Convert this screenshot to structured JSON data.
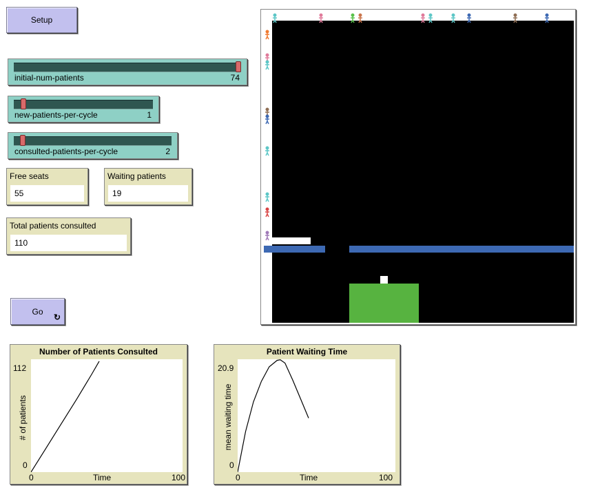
{
  "buttons": {
    "setup": {
      "label": "Setup"
    },
    "go": {
      "label": "Go",
      "forever_icon": "forever-arrows-icon",
      "forever_glyph": "↻"
    }
  },
  "sliders": [
    {
      "name": "initial-num-patients",
      "value": "74",
      "level": 1.0
    },
    {
      "name": "new-patients-per-cycle",
      "value": "1",
      "level": 0.05
    },
    {
      "name": "consulted-patients-per-cycle",
      "value": "2",
      "level": 0.04
    }
  ],
  "monitors": {
    "free_seats": {
      "label": "Free seats",
      "value": "55"
    },
    "waiting_patients": {
      "label": "Waiting patients",
      "value": "19"
    },
    "total_consulted": {
      "label": "Total patients consulted",
      "value": "110"
    }
  },
  "world": {
    "background": "#000000",
    "wall_color": "#3d69b3",
    "doctor_room_color": "#57b340",
    "patient_colors": [
      "#5cc7c7",
      "#e07a9a",
      "#58c24a",
      "#c9744a",
      "#3d69b3",
      "#8f6e54",
      "#f07a30",
      "#a07ab8",
      "#d94444"
    ]
  },
  "plots": [
    {
      "title": "Number of Patients Consulted",
      "ylabel": "# of patients",
      "xlabel": "Time",
      "xmin": "0",
      "xmax": "100",
      "ymin": "0",
      "ymax": "112"
    },
    {
      "title": "Patient Waiting Time",
      "ylabel": "mean waiting time",
      "xlabel": "Time",
      "xmin": "0",
      "xmax": "100",
      "ymin": "0",
      "ymax": "20.9"
    }
  ],
  "chart_data": [
    {
      "type": "line",
      "title": "Number of Patients Consulted",
      "xlabel": "Time",
      "ylabel": "# of patients",
      "xlim": [
        0,
        100
      ],
      "ylim": [
        0,
        112
      ],
      "x": [
        0,
        10,
        20,
        30,
        40,
        45
      ],
      "y": [
        0,
        24,
        48,
        72,
        97,
        110
      ]
    },
    {
      "type": "line",
      "title": "Patient Waiting Time",
      "xlabel": "Time",
      "ylabel": "mean waiting time",
      "xlim": [
        0,
        100
      ],
      "ylim": [
        0,
        20.9
      ],
      "x": [
        0,
        5,
        10,
        15,
        20,
        25,
        27,
        30,
        35,
        40,
        45
      ],
      "y": [
        0,
        7.5,
        13,
        16.8,
        19.5,
        20.7,
        20.8,
        20.2,
        17,
        13.5,
        10
      ]
    }
  ]
}
